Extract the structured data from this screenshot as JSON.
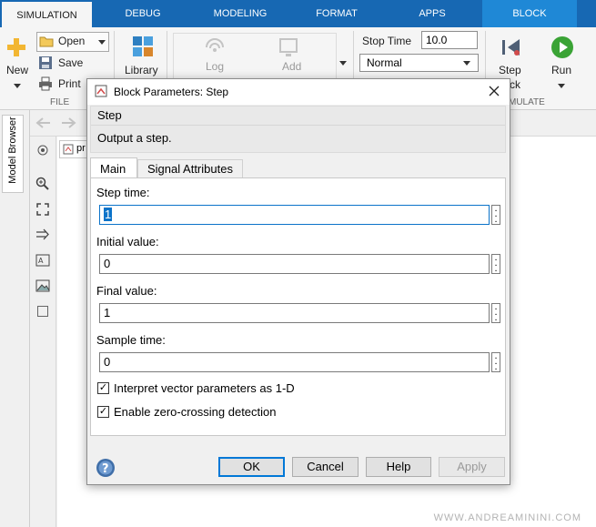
{
  "tabs": [
    {
      "label": "SIMULATION",
      "active": true
    },
    {
      "label": "DEBUG"
    },
    {
      "label": "MODELING"
    },
    {
      "label": "FORMAT"
    },
    {
      "label": "APPS"
    },
    {
      "label": "BLOCK",
      "contextual": true
    }
  ],
  "ribbon": {
    "new_label": "New",
    "open_label": "Open",
    "save_label": "Save",
    "print_label": "Print",
    "file_group": "FILE",
    "library_label": "Library",
    "log_label": "Log",
    "add_label": "Add",
    "stop_time_label": "Stop Time",
    "stop_time_value": "10.0",
    "sim_mode": "Normal",
    "step_label": "Step",
    "step_suffix": "ck",
    "run_label": "Run",
    "simulate_group": "MULATE"
  },
  "left_panel": {
    "model_browser_tab": "Model Browser",
    "breadcrumb_text": "pr"
  },
  "dialog": {
    "title": "Block Parameters: Step",
    "block_type": "Step",
    "description": "Output a step.",
    "tabs": [
      "Main",
      "Signal Attributes"
    ],
    "params": {
      "step_time_label": "Step time:",
      "step_time_value": "1",
      "initial_value_label": "Initial value:",
      "initial_value_value": "0",
      "final_value_label": "Final value:",
      "final_value_value": "1",
      "sample_time_label": "Sample time:",
      "sample_time_value": "0"
    },
    "checkboxes": {
      "interpret_label": "Interpret vector parameters as 1-D",
      "interpret_checked": true,
      "zero_crossing_label": "Enable zero-crossing detection",
      "zero_crossing_checked": true
    },
    "buttons": {
      "ok": "OK",
      "cancel": "Cancel",
      "help": "Help",
      "apply": "Apply"
    }
  },
  "watermark": "WWW.ANDREAMININI.COM",
  "colors": {
    "tab_bar": "#1768b3",
    "contextual_tab": "#1f88d6",
    "focus_border": "#0b73c9",
    "run_green": "#3aa335"
  }
}
